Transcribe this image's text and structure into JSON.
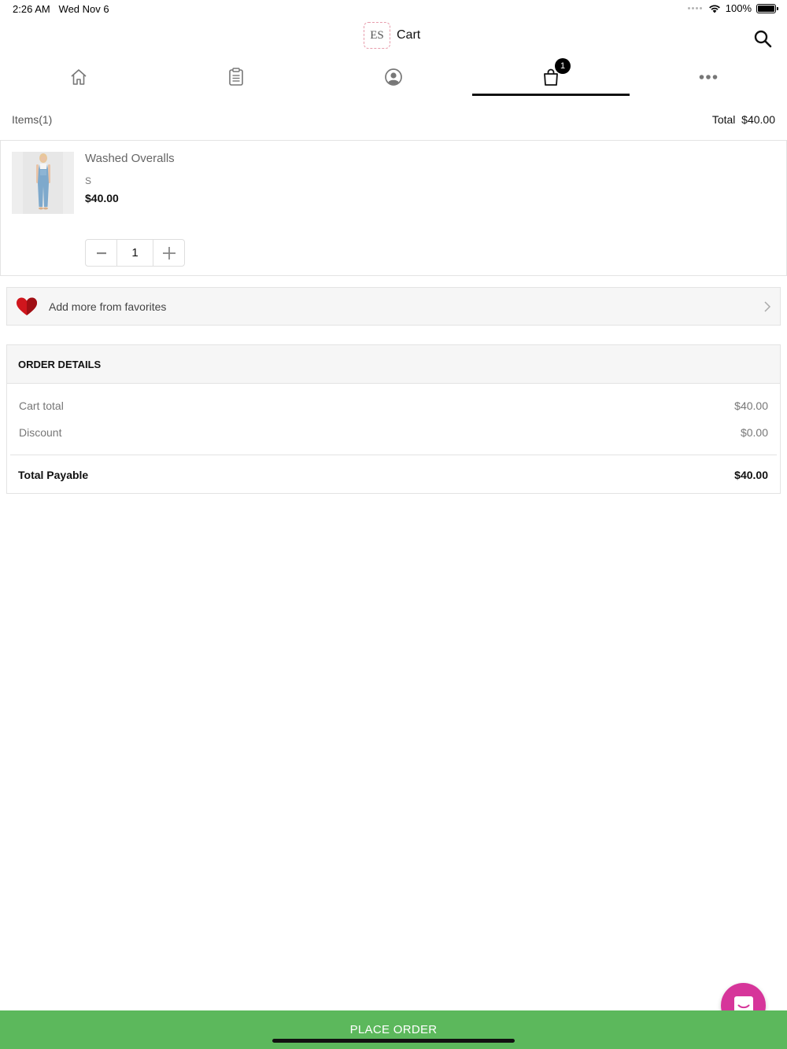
{
  "status_bar": {
    "time": "2:26 AM",
    "date": "Wed Nov 6",
    "battery": "100%"
  },
  "header": {
    "logo_text": "ES",
    "title": "Cart",
    "search_icon": "search-icon"
  },
  "tabs": [
    {
      "icon": "home-icon",
      "active": false
    },
    {
      "icon": "clipboard-icon",
      "active": false
    },
    {
      "icon": "profile-icon",
      "active": false
    },
    {
      "icon": "shopping-bag-icon",
      "active": true,
      "badge": "1"
    },
    {
      "icon": "more-icon",
      "active": false
    }
  ],
  "cart_summary": {
    "items_label": "Items",
    "items_count": "(1)",
    "total_label": "Total",
    "total_value": "$40.00"
  },
  "cart_item": {
    "name": "Washed Overalls",
    "size": "S",
    "price": "$40.00",
    "quantity": "1",
    "minus": "−",
    "plus": "+"
  },
  "favorites": {
    "label": "Add more from favorites",
    "icon": "heart-icon"
  },
  "order_details": {
    "heading": "ORDER DETAILS",
    "cart_total_label": "Cart total",
    "cart_total_value": "$40.00",
    "discount_label": "Discount",
    "discount_value": "$0.00",
    "total_payable_label": "Total Payable",
    "total_payable_value": "$40.00"
  },
  "footer": {
    "place_order_label": "PLACE ORDER"
  },
  "colors": {
    "place_order_bg": "#5cb85c",
    "chat_bg": "#d6359a",
    "heart": "#d0161d"
  }
}
